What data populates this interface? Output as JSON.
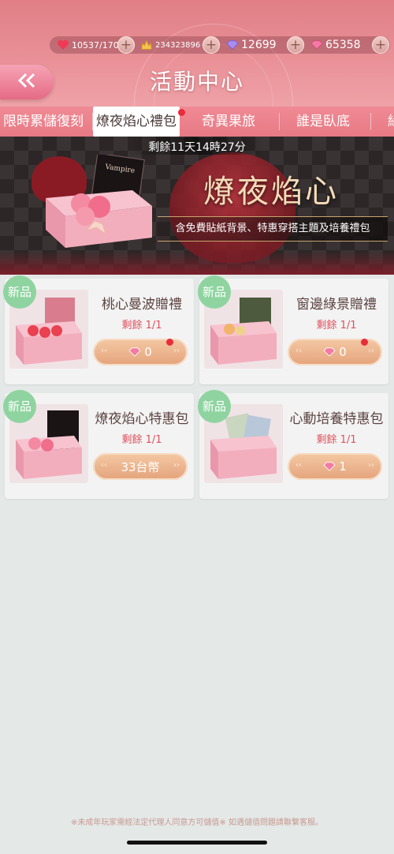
{
  "colors": {
    "accent": "#e77a85",
    "badge": "#8fd4a0",
    "price_button": "#e4a37c",
    "remain_text": "#e0505e"
  },
  "resources": [
    {
      "icon": "heart-icon",
      "value": "10537/170"
    },
    {
      "icon": "gold-bell-icon",
      "value": "234323896"
    },
    {
      "icon": "purple-diamond-icon",
      "value": "12699"
    },
    {
      "icon": "pink-diamond-icon",
      "value": "65358"
    }
  ],
  "header": {
    "title": "活動中心"
  },
  "tabs": [
    {
      "label": "限時累儲復刻",
      "active": false
    },
    {
      "label": "燎夜焰心禮包",
      "active": true
    },
    {
      "label": "奇異果旅",
      "active": false
    },
    {
      "label": "誰是臥底",
      "active": false
    },
    {
      "label": "緣",
      "active": false
    }
  ],
  "banner": {
    "timer": "剩餘11天14時27分",
    "title": "燎夜焰心",
    "subtitle": "含免費貼紙背景、特惠穿搭主題及培養禮包",
    "box_card_text": "Vampire"
  },
  "cards": [
    {
      "badge": "新品",
      "name": "桃心曼波贈禮",
      "remain": "剩餘 1/1",
      "price": "0",
      "price_icon": "pink-diamond-icon",
      "has_dot": true
    },
    {
      "badge": "新品",
      "name": "窗邊綠景贈禮",
      "remain": "剩餘 1/1",
      "price": "0",
      "price_icon": "pink-diamond-icon",
      "has_dot": true
    },
    {
      "badge": "新品",
      "name": "燎夜焰心特惠包",
      "remain": "剩餘 1/1",
      "price": "33台幣",
      "price_icon": "",
      "has_dot": false
    },
    {
      "badge": "新品",
      "name": "心動培養特惠包",
      "remain": "剩餘 1/1",
      "price": "1",
      "price_icon": "pink-diamond-icon",
      "has_dot": false
    }
  ],
  "footer": {
    "notice": "※未成年玩家需經法定代理人同意方可儲值※ 如遇儲值問題請聯繫客服。"
  }
}
